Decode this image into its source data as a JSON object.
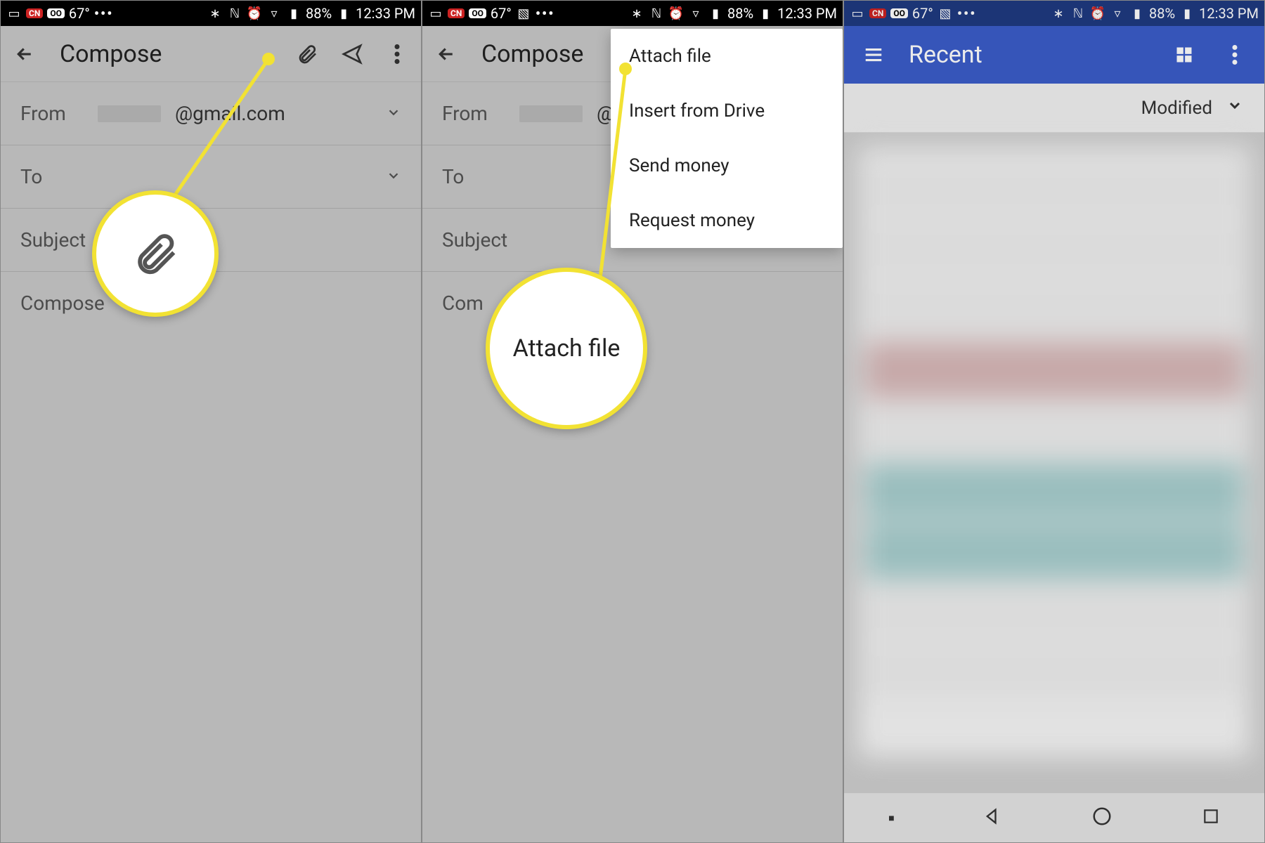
{
  "statusbar": {
    "temp": "67°",
    "battery": "88%",
    "time": "12:33 PM"
  },
  "compose": {
    "title": "Compose",
    "from_label": "From",
    "from_value": "@gmail.com",
    "to_label": "To",
    "subject_label": "Subject",
    "body_placeholder": "Compose"
  },
  "menu": {
    "items": [
      "Attach file",
      "Insert from Drive",
      "Send money",
      "Request money"
    ]
  },
  "callouts": {
    "attach_icon_callout": "paperclip-icon",
    "attach_file_callout": "Attach file"
  },
  "picker": {
    "title": "Recent",
    "sort_label": "Modified"
  }
}
